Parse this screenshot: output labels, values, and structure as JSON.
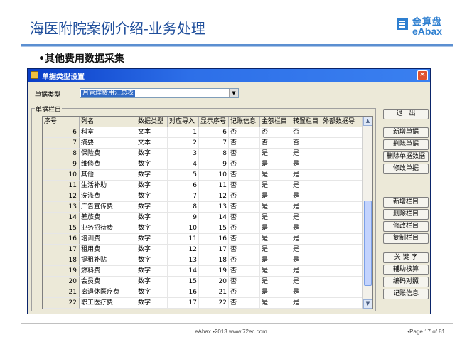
{
  "slide": {
    "title": "海医附院案例介绍-业务处理",
    "subtitle": "•其他费用数据采集",
    "logo_cn": "金算盘",
    "logo_en": "eAbax",
    "accent": "#1f4e9b"
  },
  "dialog": {
    "title": "单据类型设置",
    "close": "✕",
    "type_label": "单据类型",
    "type_value": "月管理费用汇总表",
    "group_label": "单据栏目",
    "columns": [
      "序号",
      "列名",
      "数据类型",
      "对应导入",
      "显示序号",
      "记账信息",
      "金额栏目",
      "转置栏目",
      "外部数据导"
    ],
    "rows": [
      {
        "no": "6",
        "name": "科室",
        "type": "文本",
        "imp": "1",
        "disp": "6",
        "acct": "否",
        "amt": "否",
        "trans": "否"
      },
      {
        "no": "7",
        "name": "摘要",
        "type": "文本",
        "imp": "2",
        "disp": "7",
        "acct": "否",
        "amt": "否",
        "trans": "否"
      },
      {
        "no": "8",
        "name": "保险费",
        "type": "数字",
        "imp": "3",
        "disp": "8",
        "acct": "否",
        "amt": "是",
        "trans": "是"
      },
      {
        "no": "9",
        "name": "维修费",
        "type": "数字",
        "imp": "4",
        "disp": "9",
        "acct": "否",
        "amt": "是",
        "trans": "是"
      },
      {
        "no": "10",
        "name": "其他",
        "type": "数字",
        "imp": "5",
        "disp": "10",
        "acct": "否",
        "amt": "是",
        "trans": "是"
      },
      {
        "no": "11",
        "name": "生活补助",
        "type": "数字",
        "imp": "6",
        "disp": "11",
        "acct": "否",
        "amt": "是",
        "trans": "是"
      },
      {
        "no": "12",
        "name": "洗涤费",
        "type": "数字",
        "imp": "7",
        "disp": "12",
        "acct": "否",
        "amt": "是",
        "trans": "是"
      },
      {
        "no": "13",
        "name": "广告宣传费",
        "type": "数字",
        "imp": "8",
        "disp": "13",
        "acct": "否",
        "amt": "是",
        "trans": "是"
      },
      {
        "no": "14",
        "name": "差旅费",
        "type": "数字",
        "imp": "9",
        "disp": "14",
        "acct": "否",
        "amt": "是",
        "trans": "是"
      },
      {
        "no": "15",
        "name": "业务招待费",
        "type": "数字",
        "imp": "10",
        "disp": "15",
        "acct": "否",
        "amt": "是",
        "trans": "是"
      },
      {
        "no": "16",
        "name": "培训费",
        "type": "数字",
        "imp": "11",
        "disp": "16",
        "acct": "否",
        "amt": "是",
        "trans": "是"
      },
      {
        "no": "17",
        "name": "租用费",
        "type": "数字",
        "imp": "12",
        "disp": "17",
        "acct": "否",
        "amt": "是",
        "trans": "是"
      },
      {
        "no": "18",
        "name": "提租补贴",
        "type": "数字",
        "imp": "13",
        "disp": "18",
        "acct": "否",
        "amt": "是",
        "trans": "是"
      },
      {
        "no": "19",
        "name": "燃料费",
        "type": "数字",
        "imp": "14",
        "disp": "19",
        "acct": "否",
        "amt": "是",
        "trans": "是"
      },
      {
        "no": "20",
        "name": "会员费",
        "type": "数字",
        "imp": "15",
        "disp": "20",
        "acct": "否",
        "amt": "是",
        "trans": "是"
      },
      {
        "no": "21",
        "name": "离退休医疗费",
        "type": "数字",
        "imp": "16",
        "disp": "21",
        "acct": "否",
        "amt": "是",
        "trans": "是"
      },
      {
        "no": "22",
        "name": "职工医疗费",
        "type": "数字",
        "imp": "17",
        "disp": "22",
        "acct": "否",
        "amt": "是",
        "trans": "是"
      }
    ],
    "buttons": {
      "exit": "退　出",
      "new_doc": "新增单据",
      "del_doc": "删除单据",
      "del_doc_data": "删除单据数据",
      "edit_doc": "修改单据",
      "new_col": "新增栏目",
      "del_col": "删除栏目",
      "edit_col": "修改栏目",
      "copy_col": "复制栏目",
      "keyword": "关 键 字",
      "aux_check": "辅助核算",
      "code_map": "编码对照",
      "acct_info": "记账信息"
    }
  },
  "footer": {
    "center": "eAbax  •2013  www.72ec.com",
    "page": "•Page 17 of  81"
  }
}
